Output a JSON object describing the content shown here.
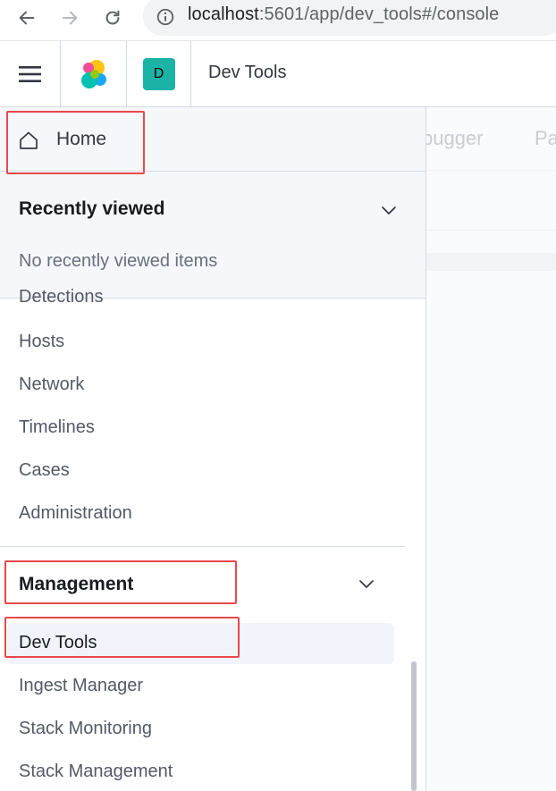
{
  "browser": {
    "url_host": "localhost",
    "url_rest": ":5601/app/dev_tools#/console",
    "back_icon": "arrow-left-icon",
    "forward_icon": "arrow-right-icon",
    "reload_icon": "reload-icon",
    "info_icon": "info-icon"
  },
  "header": {
    "space_letter": "D",
    "title": "Dev Tools",
    "accent": "#1bb3a6"
  },
  "background": {
    "tab_partial_1": "bugger",
    "tab_partial_2": "Pa"
  },
  "nav": {
    "home_label": "Home",
    "recently_viewed_title": "Recently viewed",
    "recently_viewed_empty": "No recently viewed items",
    "security_items": [
      "Detections",
      "Hosts",
      "Network",
      "Timelines",
      "Cases",
      "Administration"
    ],
    "management_title": "Management",
    "management_items": [
      "Dev Tools",
      "Ingest Manager",
      "Stack Monitoring",
      "Stack Management"
    ]
  },
  "annotation_color": "#e8494c"
}
